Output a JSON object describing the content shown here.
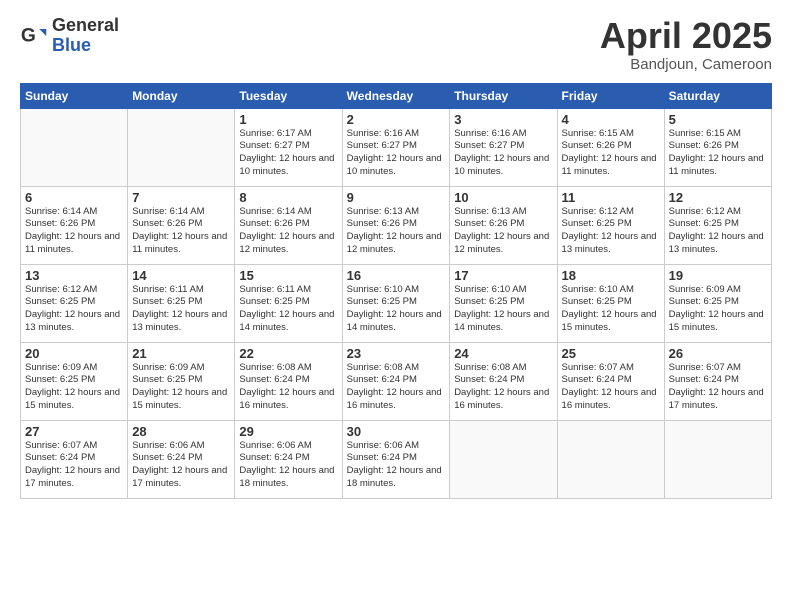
{
  "logo": {
    "general": "General",
    "blue": "Blue"
  },
  "title": {
    "month": "April 2025",
    "location": "Bandjoun, Cameroon"
  },
  "weekdays": [
    "Sunday",
    "Monday",
    "Tuesday",
    "Wednesday",
    "Thursday",
    "Friday",
    "Saturday"
  ],
  "weeks": [
    [
      {
        "day": "",
        "info": ""
      },
      {
        "day": "",
        "info": ""
      },
      {
        "day": "1",
        "info": "Sunrise: 6:17 AM\nSunset: 6:27 PM\nDaylight: 12 hours and 10 minutes."
      },
      {
        "day": "2",
        "info": "Sunrise: 6:16 AM\nSunset: 6:27 PM\nDaylight: 12 hours and 10 minutes."
      },
      {
        "day": "3",
        "info": "Sunrise: 6:16 AM\nSunset: 6:27 PM\nDaylight: 12 hours and 10 minutes."
      },
      {
        "day": "4",
        "info": "Sunrise: 6:15 AM\nSunset: 6:26 PM\nDaylight: 12 hours and 11 minutes."
      },
      {
        "day": "5",
        "info": "Sunrise: 6:15 AM\nSunset: 6:26 PM\nDaylight: 12 hours and 11 minutes."
      }
    ],
    [
      {
        "day": "6",
        "info": "Sunrise: 6:14 AM\nSunset: 6:26 PM\nDaylight: 12 hours and 11 minutes."
      },
      {
        "day": "7",
        "info": "Sunrise: 6:14 AM\nSunset: 6:26 PM\nDaylight: 12 hours and 11 minutes."
      },
      {
        "day": "8",
        "info": "Sunrise: 6:14 AM\nSunset: 6:26 PM\nDaylight: 12 hours and 12 minutes."
      },
      {
        "day": "9",
        "info": "Sunrise: 6:13 AM\nSunset: 6:26 PM\nDaylight: 12 hours and 12 minutes."
      },
      {
        "day": "10",
        "info": "Sunrise: 6:13 AM\nSunset: 6:26 PM\nDaylight: 12 hours and 12 minutes."
      },
      {
        "day": "11",
        "info": "Sunrise: 6:12 AM\nSunset: 6:25 PM\nDaylight: 12 hours and 13 minutes."
      },
      {
        "day": "12",
        "info": "Sunrise: 6:12 AM\nSunset: 6:25 PM\nDaylight: 12 hours and 13 minutes."
      }
    ],
    [
      {
        "day": "13",
        "info": "Sunrise: 6:12 AM\nSunset: 6:25 PM\nDaylight: 12 hours and 13 minutes."
      },
      {
        "day": "14",
        "info": "Sunrise: 6:11 AM\nSunset: 6:25 PM\nDaylight: 12 hours and 13 minutes."
      },
      {
        "day": "15",
        "info": "Sunrise: 6:11 AM\nSunset: 6:25 PM\nDaylight: 12 hours and 14 minutes."
      },
      {
        "day": "16",
        "info": "Sunrise: 6:10 AM\nSunset: 6:25 PM\nDaylight: 12 hours and 14 minutes."
      },
      {
        "day": "17",
        "info": "Sunrise: 6:10 AM\nSunset: 6:25 PM\nDaylight: 12 hours and 14 minutes."
      },
      {
        "day": "18",
        "info": "Sunrise: 6:10 AM\nSunset: 6:25 PM\nDaylight: 12 hours and 15 minutes."
      },
      {
        "day": "19",
        "info": "Sunrise: 6:09 AM\nSunset: 6:25 PM\nDaylight: 12 hours and 15 minutes."
      }
    ],
    [
      {
        "day": "20",
        "info": "Sunrise: 6:09 AM\nSunset: 6:25 PM\nDaylight: 12 hours and 15 minutes."
      },
      {
        "day": "21",
        "info": "Sunrise: 6:09 AM\nSunset: 6:25 PM\nDaylight: 12 hours and 15 minutes."
      },
      {
        "day": "22",
        "info": "Sunrise: 6:08 AM\nSunset: 6:24 PM\nDaylight: 12 hours and 16 minutes."
      },
      {
        "day": "23",
        "info": "Sunrise: 6:08 AM\nSunset: 6:24 PM\nDaylight: 12 hours and 16 minutes."
      },
      {
        "day": "24",
        "info": "Sunrise: 6:08 AM\nSunset: 6:24 PM\nDaylight: 12 hours and 16 minutes."
      },
      {
        "day": "25",
        "info": "Sunrise: 6:07 AM\nSunset: 6:24 PM\nDaylight: 12 hours and 16 minutes."
      },
      {
        "day": "26",
        "info": "Sunrise: 6:07 AM\nSunset: 6:24 PM\nDaylight: 12 hours and 17 minutes."
      }
    ],
    [
      {
        "day": "27",
        "info": "Sunrise: 6:07 AM\nSunset: 6:24 PM\nDaylight: 12 hours and 17 minutes."
      },
      {
        "day": "28",
        "info": "Sunrise: 6:06 AM\nSunset: 6:24 PM\nDaylight: 12 hours and 17 minutes."
      },
      {
        "day": "29",
        "info": "Sunrise: 6:06 AM\nSunset: 6:24 PM\nDaylight: 12 hours and 18 minutes."
      },
      {
        "day": "30",
        "info": "Sunrise: 6:06 AM\nSunset: 6:24 PM\nDaylight: 12 hours and 18 minutes."
      },
      {
        "day": "",
        "info": ""
      },
      {
        "day": "",
        "info": ""
      },
      {
        "day": "",
        "info": ""
      }
    ]
  ]
}
